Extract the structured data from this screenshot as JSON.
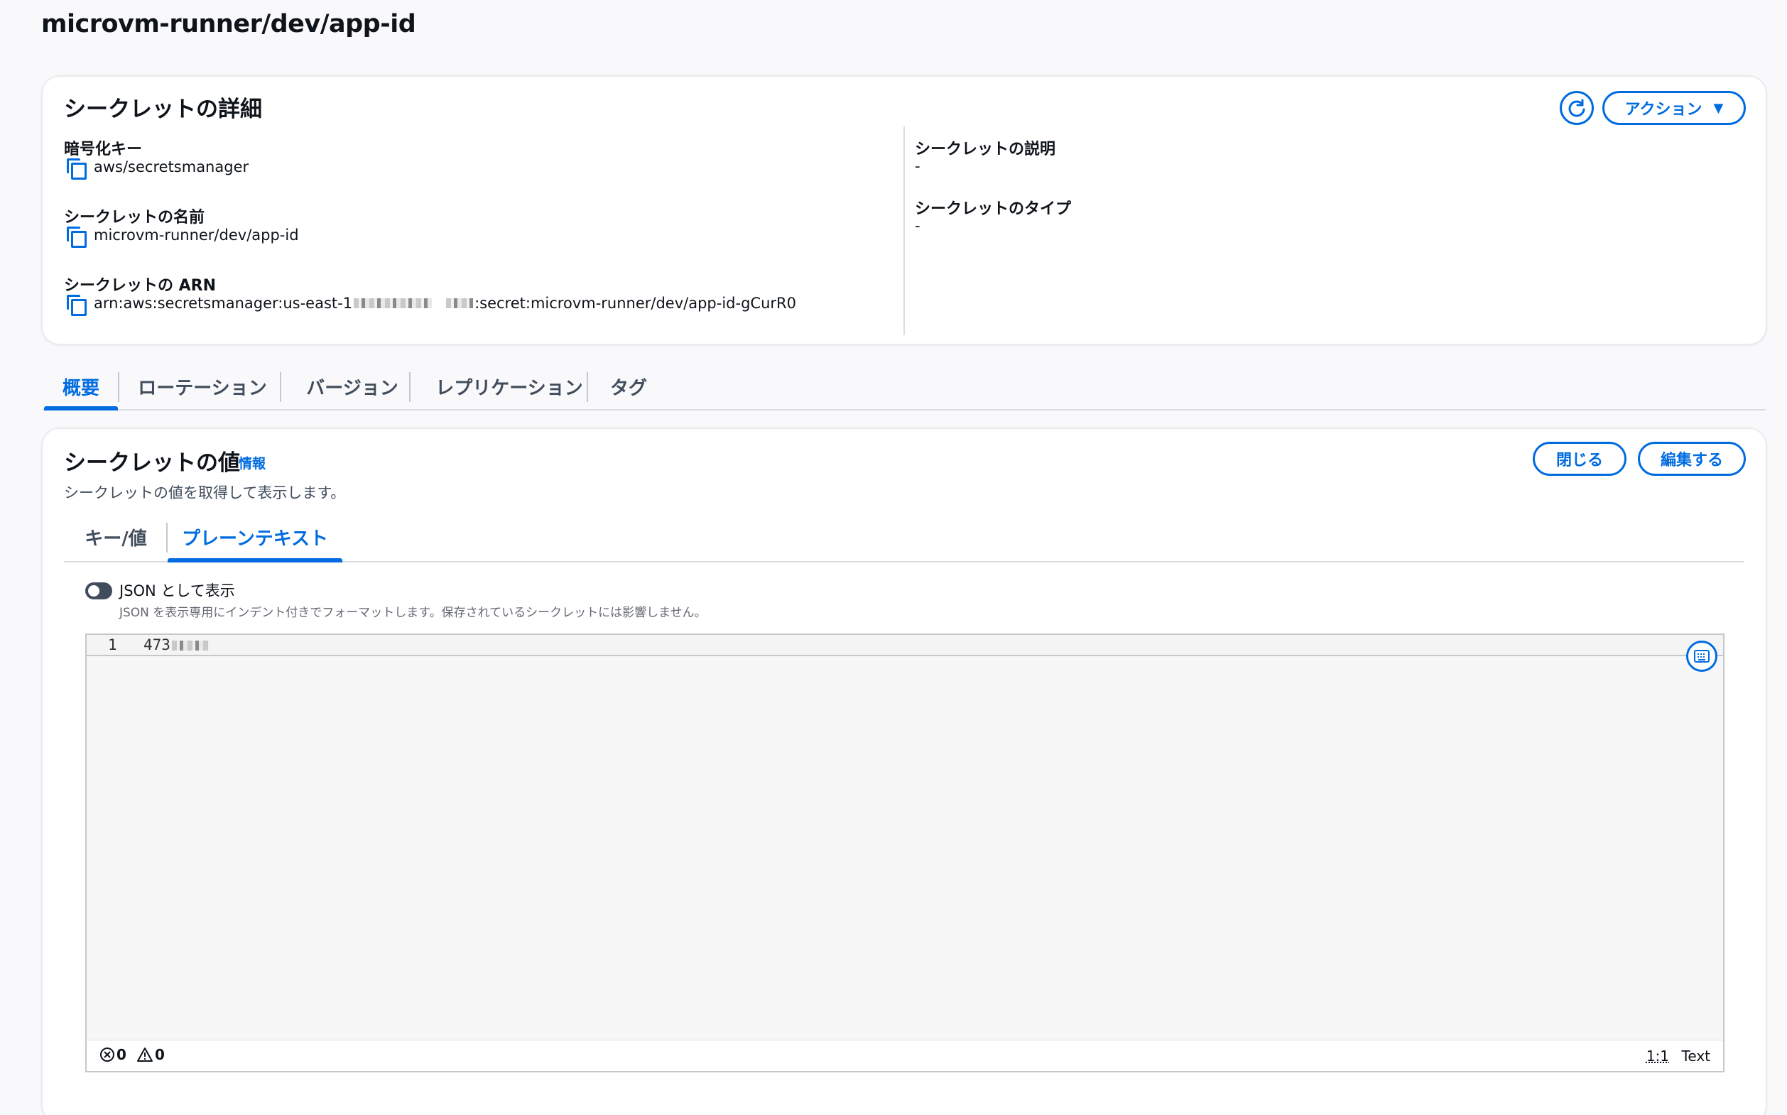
{
  "page": {
    "title": "microvm-runner/dev/app-id"
  },
  "details": {
    "title": "シークレットの詳細",
    "actions_label": "アクション",
    "fields_left": [
      {
        "label": "暗号化キー",
        "value": "aws/secretsmanager"
      },
      {
        "label": "シークレットの名前",
        "value": "microvm-runner/dev/app-id"
      },
      {
        "label": "シークレットの ARN",
        "value_prefix": "arn:aws:secretsmanager:us-east-1",
        "value_suffix": ":secret:microvm-runner/dev/app-id-gCurR0"
      }
    ],
    "fields_right": [
      {
        "label": "シークレットの説明",
        "value": "-"
      },
      {
        "label": "シークレットのタイプ",
        "value": "-"
      }
    ]
  },
  "tabs": [
    "概要",
    "ローテーション",
    "バージョン",
    "レプリケーション",
    "タグ"
  ],
  "secret_value": {
    "title": "シークレットの値",
    "info_label": "情報",
    "description": "シークレットの値を取得して表示します。",
    "close_label": "閉じる",
    "edit_label": "編集する",
    "subtabs": [
      "キー/値",
      "プレーンテキスト"
    ],
    "json_toggle_label": "JSON として表示",
    "json_toggle_help": "JSON を表示専用にインデント付きでフォーマットします。保存されているシークレットには影響しません。",
    "editor": {
      "line_number": "1",
      "value_visible": "473",
      "errors": "0",
      "warnings": "0",
      "position": "1:1",
      "language": "Text"
    }
  }
}
